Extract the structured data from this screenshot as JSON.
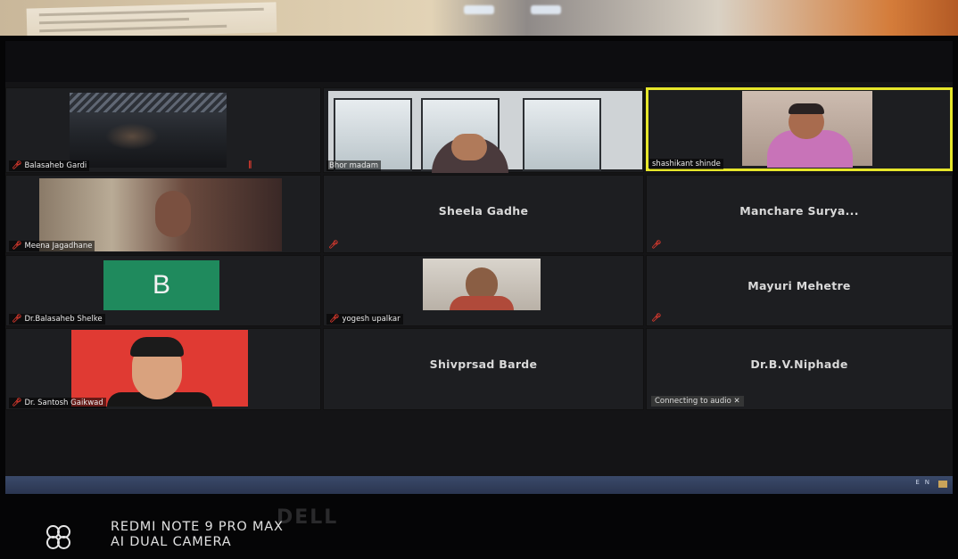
{
  "participants": [
    {
      "name": "Balasaheb Gardi"
    },
    {
      "name": "Bhor madam"
    },
    {
      "name": "shashikant shinde"
    },
    {
      "name": "Meena Jagadhane"
    },
    {
      "name": "Sheela Gadhe"
    },
    {
      "name": "Manchare  Surya..."
    },
    {
      "name": "Dr.Balasaheb Shelke",
      "avatar_letter": "B"
    },
    {
      "name": "yogesh upalkar"
    },
    {
      "name": "Mayuri Mehetre"
    },
    {
      "name": "Dr. Santosh Gaikwad"
    },
    {
      "name": "Shivprsad Barde"
    },
    {
      "name": "Dr.B.V.Niphade",
      "status": "Connecting to audio ✕"
    }
  ],
  "taskbar": {
    "lang": "EN"
  },
  "monitor_brand": "DELL",
  "camera_watermark": {
    "line1": "REDMI NOTE 9 PRO MAX",
    "line2": "AI DUAL CAMERA"
  },
  "colors": {
    "active_speaker_border": "#e6e62a",
    "muted_mic": "#e53b2f",
    "avatar_bg": "#1f8a5d"
  },
  "icons": {
    "muted": "muted-mic-icon"
  }
}
